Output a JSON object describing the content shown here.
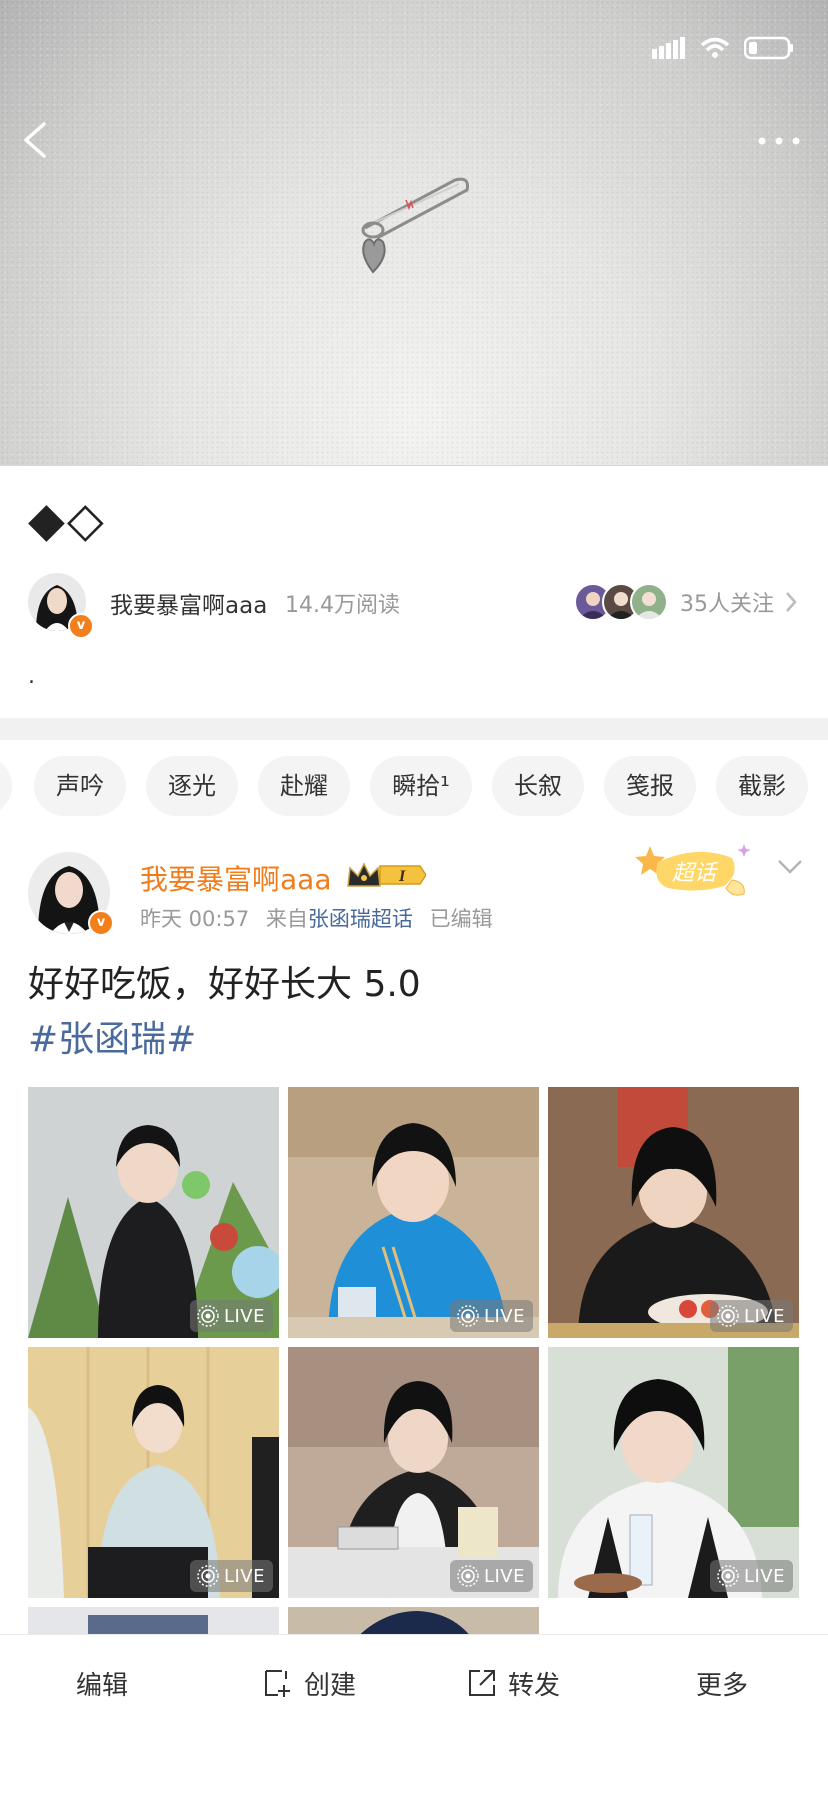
{
  "status_bar": {
    "signal_icon": "signal-icon",
    "wifi_icon": "wifi-icon",
    "battery_icon": "battery-icon"
  },
  "header": {
    "back_icon": "chevron-left-icon",
    "more_icon": "more-dots-icon",
    "cover_icon": "safety-pin-heart-icon"
  },
  "topic": {
    "title": "◆◇",
    "owner_name": "我要暴富啊aaa",
    "read_count": "14.4万阅读",
    "followers_text": "35人关注",
    "body": "."
  },
  "tags": [
    "声吟",
    "逐光",
    "赴耀",
    "瞬拾¹",
    "长叙",
    "笺报",
    "截影"
  ],
  "post": {
    "author": "我要暴富啊aaa",
    "level": "I",
    "time": "昨天 00:57",
    "from_prefix": "来自",
    "from_link": "张函瑞超话",
    "edited": "已编辑",
    "chaohua_badge": "超话",
    "text": "好好吃饭，好好长大 5.0",
    "hashtag": "#张函瑞#",
    "live_label": "LIVE"
  },
  "bottom_bar": {
    "edit": "编辑",
    "create": "创建",
    "repost": "转发",
    "more": "更多"
  },
  "colors": {
    "accent_orange": "#f27c1a",
    "link_blue": "#4a6a9e",
    "muted": "#999999",
    "divider": "#f1f1f1"
  }
}
